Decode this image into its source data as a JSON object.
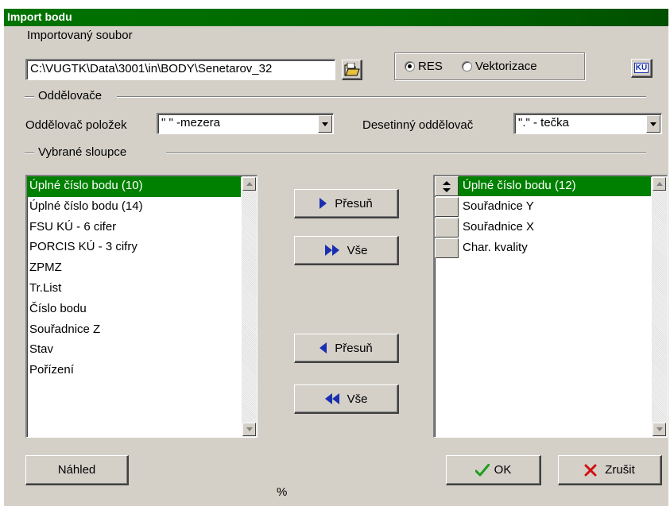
{
  "window": {
    "title": "Import bodu"
  },
  "file": {
    "label": "Importovaný soubor",
    "path": "C:\\VUGTK\\Data\\3001\\in\\BODY\\Senetarov_32"
  },
  "format": {
    "options": [
      {
        "label": "RES",
        "selected": true
      },
      {
        "label": "Vektorizace",
        "selected": false
      }
    ],
    "ku_button": "KÚ"
  },
  "separators": {
    "group_label": "Oddělovače",
    "item_label": "Oddělovač položek",
    "item_value": "\" \" -mezera",
    "decimal_label": "Desetinný oddělovač",
    "decimal_value": "\".\" - tečka"
  },
  "columns": {
    "group_label": "Vybrané sloupce",
    "available": [
      {
        "label": "Úplné číslo bodu (10)",
        "selected": true
      },
      {
        "label": "Úplné číslo bodu (14)"
      },
      {
        "label": "FSU KÚ - 6 cifer"
      },
      {
        "label": "PORCIS KÚ - 3 cifry"
      },
      {
        "label": "ZPMZ"
      },
      {
        "label": "Tr.List"
      },
      {
        "label": "Číslo bodu"
      },
      {
        "label": "Souřadnice Z"
      },
      {
        "label": "Stav"
      },
      {
        "label": "Pořízení"
      }
    ],
    "selected": [
      {
        "label": "Úplné číslo bodu (12)",
        "selected": true
      },
      {
        "label": "Souřadnice Y"
      },
      {
        "label": "Souřadnice X"
      },
      {
        "label": "Char. kvality"
      }
    ]
  },
  "transfer": {
    "move_right": "Přesuň",
    "all_right": "Vše",
    "move_left": "Přesuň",
    "all_left": "Vše"
  },
  "footer": {
    "preview": "Náhled",
    "percent": "%",
    "ok": "OK",
    "cancel": "Zrušit"
  },
  "colors": {
    "title_bar": "#007300",
    "selection": "#008000",
    "arrow": "#1a2fb0",
    "ok_check": "#1e9e1e",
    "cancel_x": "#d01010"
  }
}
